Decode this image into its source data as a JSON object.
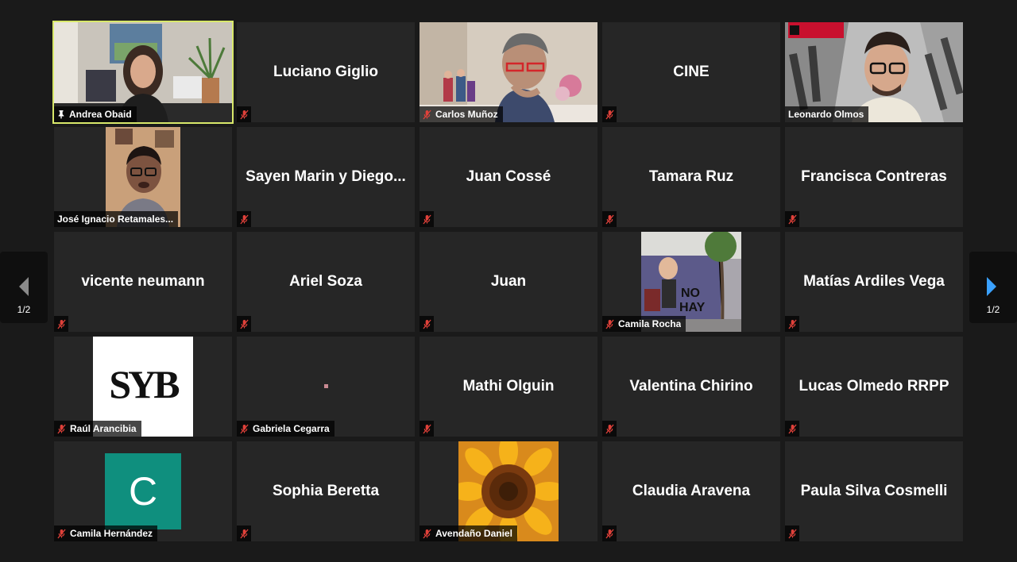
{
  "nav": {
    "prev_page": "1/2",
    "next_page": "1/2"
  },
  "colors": {
    "active_border": "#d8e86a",
    "mute_red": "#e0413a",
    "next_arrow": "#3aa1ff"
  },
  "tiles": [
    {
      "name": "Andrea Obaid",
      "type": "video",
      "pinned": true
    },
    {
      "name": "Luciano Giglio",
      "type": "name",
      "muted": true
    },
    {
      "name": "Carlos Muñoz",
      "type": "video",
      "muted": true
    },
    {
      "name": "CINE",
      "type": "name",
      "muted": true
    },
    {
      "name": "Leonardo Olmos",
      "type": "video"
    },
    {
      "name": "José Ignacio Retamales...",
      "type": "video"
    },
    {
      "name": "Sayen Marin y Diego...",
      "type": "name",
      "muted": true
    },
    {
      "name": "Juan Cossé",
      "type": "name",
      "muted": true
    },
    {
      "name": "Tamara Ruz",
      "type": "name",
      "muted": true
    },
    {
      "name": "Francisca Contreras",
      "type": "name",
      "muted": true
    },
    {
      "name": "vicente neumann",
      "type": "name",
      "muted": true
    },
    {
      "name": "Ariel Soza",
      "type": "name",
      "muted": true
    },
    {
      "name": "Juan",
      "type": "name",
      "muted": true
    },
    {
      "name": "Camila Rocha",
      "type": "image",
      "muted": true
    },
    {
      "name": "Matías Ardiles Vega",
      "type": "name",
      "muted": true
    },
    {
      "name": "Raúl Arancibia",
      "type": "image",
      "logo_text": "SYB",
      "muted": true
    },
    {
      "name": "Gabriela Cegarra",
      "type": "image",
      "muted": true
    },
    {
      "name": "Mathi Olguin",
      "type": "name",
      "muted": true
    },
    {
      "name": "Valentina Chirino",
      "type": "name",
      "muted": true
    },
    {
      "name": "Lucas Olmedo RRPP",
      "type": "name",
      "muted": true
    },
    {
      "name": "Camila Hernández",
      "type": "avatar",
      "avatar_letter": "C",
      "avatar_color": "#0f8f7e",
      "muted": true
    },
    {
      "name": "Sophia Beretta",
      "type": "name",
      "muted": true
    },
    {
      "name": "Avendaño Daniel",
      "type": "image",
      "muted": true
    },
    {
      "name": "Claudia Aravena",
      "type": "name",
      "muted": true
    },
    {
      "name": "Paula Silva Cosmelli",
      "type": "name",
      "muted": true
    }
  ]
}
